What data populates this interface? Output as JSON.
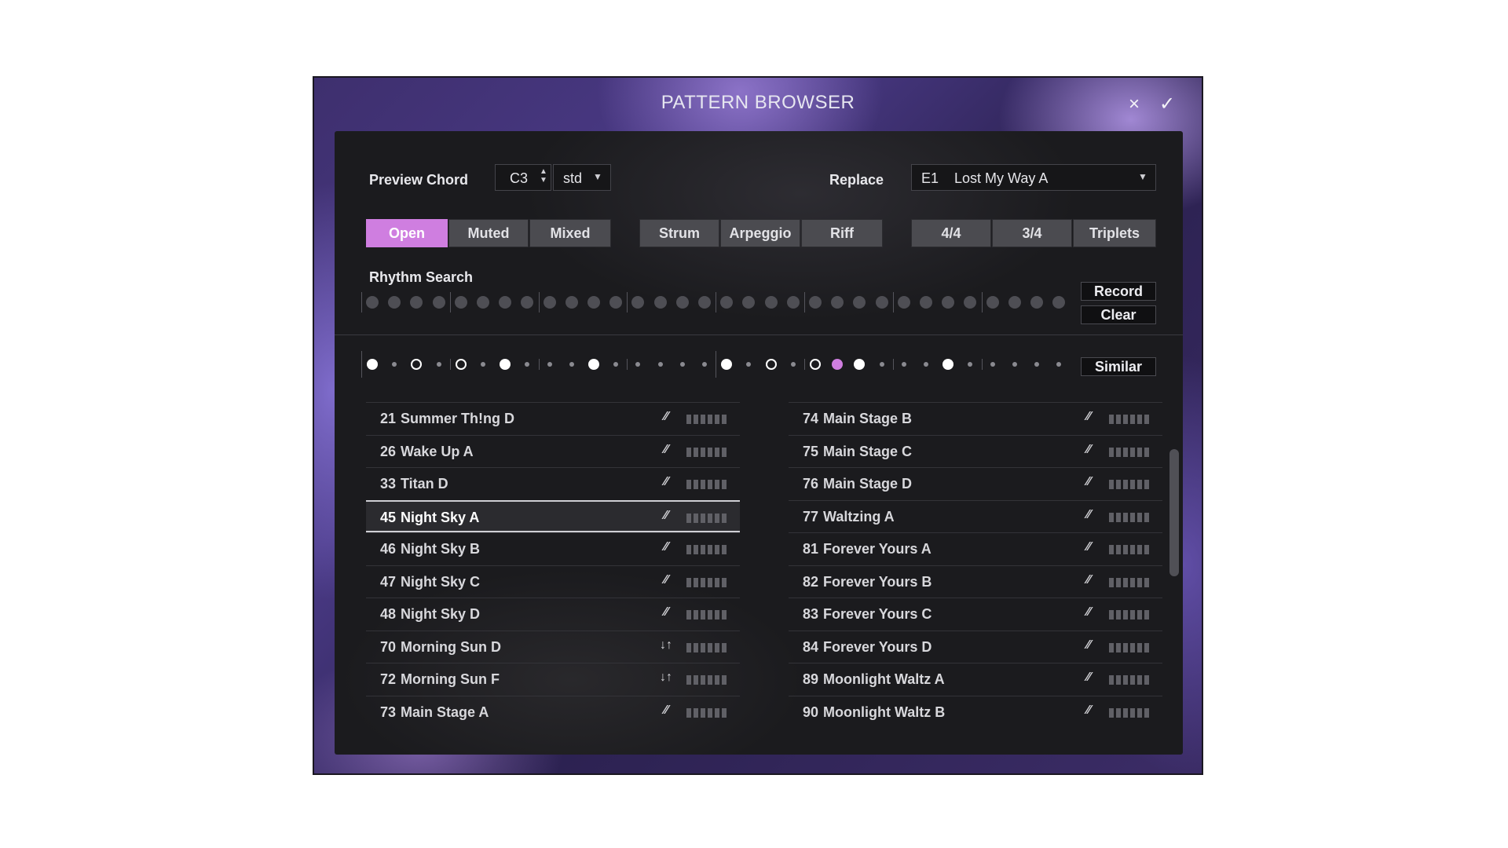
{
  "window": {
    "title": "PATTERN BROWSER",
    "close_icon": "×",
    "confirm_icon": "✓"
  },
  "preview": {
    "label": "Preview Chord",
    "note": "C3",
    "voicing": "std"
  },
  "replace": {
    "label": "Replace",
    "slot": "E1",
    "pattern": "Lost My Way A"
  },
  "filters": {
    "articulation": [
      {
        "label": "Open",
        "active": true
      },
      {
        "label": "Muted",
        "active": false
      },
      {
        "label": "Mixed",
        "active": false
      }
    ],
    "style": [
      {
        "label": "Strum"
      },
      {
        "label": "Arpeggio"
      },
      {
        "label": "Riff"
      }
    ],
    "meter": [
      {
        "label": "4/4"
      },
      {
        "label": "3/4"
      },
      {
        "label": "Triplets"
      }
    ]
  },
  "rhythm": {
    "label": "Rhythm Search",
    "record_label": "Record",
    "clear_label": "Clear",
    "similar_label": "Similar"
  },
  "pattern_steps": [
    "filled",
    "small",
    "hollow",
    "small",
    "hollow",
    "small",
    "filled",
    "small",
    "small",
    "small",
    "filled",
    "small",
    "small",
    "small",
    "small",
    "small",
    "filled",
    "small",
    "hollow",
    "small",
    "hollow",
    "accent",
    "filled",
    "small",
    "small",
    "small",
    "filled",
    "small",
    "small",
    "small",
    "small",
    "small"
  ],
  "patterns_left": [
    {
      "num": "21",
      "name": "Summer Th!ng D",
      "stroke": "strum",
      "selected": false
    },
    {
      "num": "26",
      "name": "Wake Up A",
      "stroke": "strum",
      "selected": false
    },
    {
      "num": "33",
      "name": "Titan D",
      "stroke": "strum",
      "selected": false
    },
    {
      "num": "45",
      "name": "Night Sky A",
      "stroke": "strum",
      "selected": true
    },
    {
      "num": "46",
      "name": "Night Sky B",
      "stroke": "strum",
      "selected": false
    },
    {
      "num": "47",
      "name": "Night Sky C",
      "stroke": "strum",
      "selected": false
    },
    {
      "num": "48",
      "name": "Night Sky D",
      "stroke": "strum",
      "selected": false
    },
    {
      "num": "70",
      "name": "Morning Sun D",
      "stroke": "updown",
      "selected": false
    },
    {
      "num": "72",
      "name": "Morning Sun F",
      "stroke": "updown",
      "selected": false
    },
    {
      "num": "73",
      "name": "Main Stage A",
      "stroke": "strum",
      "selected": false
    }
  ],
  "patterns_right": [
    {
      "num": "74",
      "name": "Main Stage B",
      "stroke": "strum",
      "selected": false
    },
    {
      "num": "75",
      "name": "Main Stage C",
      "stroke": "strum",
      "selected": false
    },
    {
      "num": "76",
      "name": "Main Stage D",
      "stroke": "strum",
      "selected": false
    },
    {
      "num": "77",
      "name": "Waltzing A",
      "stroke": "strum",
      "selected": false
    },
    {
      "num": "81",
      "name": "Forever Yours A",
      "stroke": "strum",
      "selected": false
    },
    {
      "num": "82",
      "name": "Forever Yours B",
      "stroke": "strum",
      "selected": false
    },
    {
      "num": "83",
      "name": "Forever Yours C",
      "stroke": "strum",
      "selected": false
    },
    {
      "num": "84",
      "name": "Forever Yours D",
      "stroke": "strum",
      "selected": false
    },
    {
      "num": "89",
      "name": "Moonlight Waltz A",
      "stroke": "strum",
      "selected": false
    },
    {
      "num": "90",
      "name": "Moonlight Waltz B",
      "stroke": "strum",
      "selected": false
    }
  ],
  "colors": {
    "accent": "#cf7ee0",
    "panel": "#1b1b1e"
  }
}
